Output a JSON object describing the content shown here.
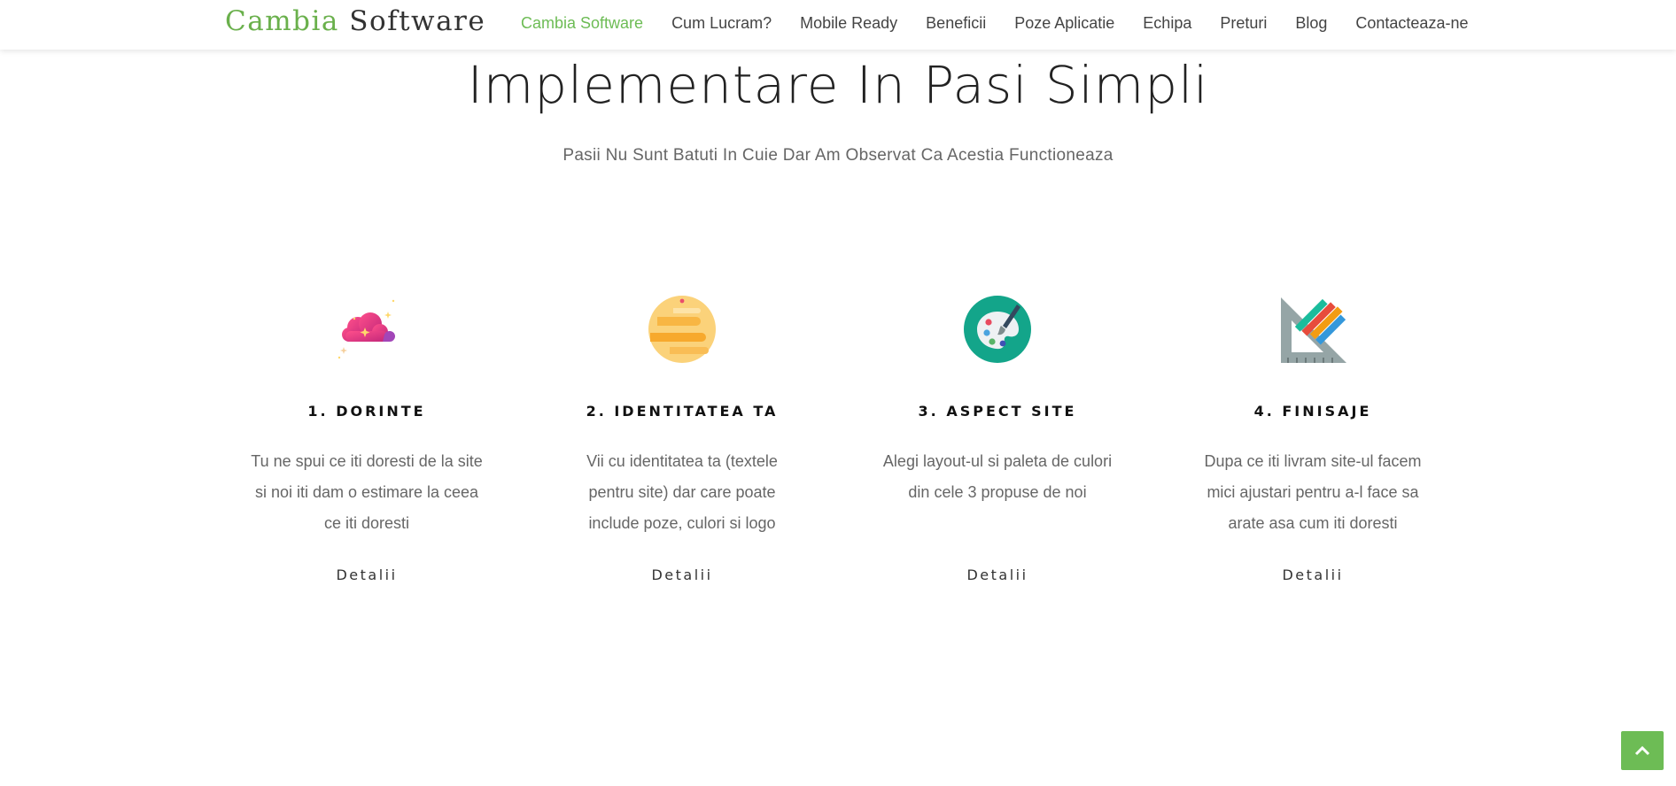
{
  "brand": {
    "part1": "Cambia",
    "part2": "Software"
  },
  "nav": {
    "items": [
      {
        "label": "Cambia Software",
        "active": true
      },
      {
        "label": "Cum Lucram?"
      },
      {
        "label": "Mobile Ready"
      },
      {
        "label": "Beneficii"
      },
      {
        "label": "Poze Aplicatie"
      },
      {
        "label": "Echipa"
      },
      {
        "label": "Preturi"
      },
      {
        "label": "Blog"
      },
      {
        "label": "Contacteaza-ne"
      }
    ]
  },
  "section": {
    "title": "Implementare In Pasi Simpli",
    "subtitle": "Pasii Nu Sunt Batuti In Cuie Dar Am Observat Ca Acestia Functioneaza"
  },
  "steps": [
    {
      "icon": "cloud-sparkle-icon",
      "title": "1. DORINTE",
      "text": "Tu ne spui ce iti doresti de la site si noi iti dam o estimare la ceea ce iti doresti",
      "link": "Detalii"
    },
    {
      "icon": "planet-icon",
      "title": "2. IDENTITATEA TA",
      "text": "Vii cu identitatea ta (textele pentru site) dar care poate include poze, culori si logo",
      "link": "Detalii"
    },
    {
      "icon": "palette-icon",
      "title": "3. ASPECT SITE",
      "text": "Alegi layout-ul si paleta de culori din cele 3 propuse de noi",
      "link": "Detalii"
    },
    {
      "icon": "ruler-pencils-icon",
      "title": "4. FINISAJE",
      "text": "Dupa ce iti livram site-ul facem mici ajustari pentru a-l face sa arate asa cum iti doresti",
      "link": "Detalii"
    }
  ],
  "colors": {
    "accent": "#6dbc55",
    "text": "#444444"
  },
  "scroll_top": {
    "icon": "chevron-up-icon"
  }
}
